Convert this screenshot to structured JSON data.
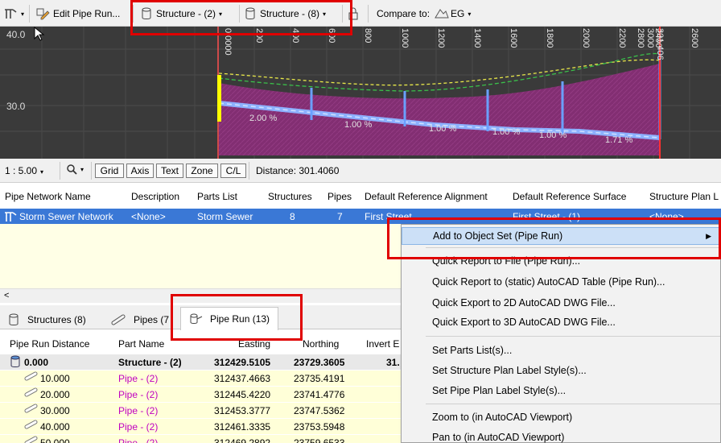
{
  "toolbar": {
    "edit_label": "Edit Pipe Run...",
    "struct_a": "Structure - (2)",
    "struct_b": "Structure - (8)",
    "compare_label": "Compare to:",
    "compare_value": "EG"
  },
  "profile": {
    "y_labels": [
      "40.0",
      "30.0"
    ],
    "stations": [
      "0.0000",
      "200",
      "400",
      "600",
      "800",
      "1000",
      "1200",
      "1400",
      "1600",
      "1800",
      "2000",
      "2200",
      "2400",
      "2600",
      "2800",
      "3000",
      "301.406"
    ],
    "slopes": [
      "2.00 %",
      "1.00 %",
      "1.00 %",
      "1.00 %",
      "1.00 %",
      "1.71 %"
    ]
  },
  "statusbar": {
    "scale": "1 : 5.00",
    "zoom_caret": "▾",
    "buttons": [
      "Grid",
      "Axis",
      "Text",
      "Zone",
      "C/L"
    ],
    "distance": "Distance: 301.4060"
  },
  "network_table": {
    "headers": [
      "Pipe Network Name",
      "Description",
      "Parts List",
      "Structures",
      "Pipes",
      "Default Reference Alignment",
      "Default Reference Surface",
      "Structure Plan L"
    ],
    "row": [
      "Storm Sewer Network",
      "<None>",
      "Storm Sewer",
      "8",
      "7",
      "First Street",
      "First Street - (1)",
      "<None>"
    ]
  },
  "tabs": {
    "structures": "Structures (8)",
    "pipes": "Pipes (7",
    "piperun": "Pipe Run (13)"
  },
  "run_table": {
    "headers": [
      "Pipe Run Distance",
      "Part Name",
      "Easting",
      "Northing",
      "Invert E"
    ],
    "rows": [
      {
        "dist": "0.000",
        "part": "Structure - (2)",
        "easting": "312429.5105",
        "northing": "23729.3605",
        "invert": "31."
      },
      {
        "dist": "10.000",
        "part": "Pipe - (2)",
        "easting": "312437.4663",
        "northing": "23735.4191",
        "invert": ""
      },
      {
        "dist": "20.000",
        "part": "Pipe - (2)",
        "easting": "312445.4220",
        "northing": "23741.4776",
        "invert": ""
      },
      {
        "dist": "30.000",
        "part": "Pipe - (2)",
        "easting": "312453.3777",
        "northing": "23747.5362",
        "invert": ""
      },
      {
        "dist": "40.000",
        "part": "Pipe - (2)",
        "easting": "312461.3335",
        "northing": "23753.5948",
        "invert": ""
      },
      {
        "dist": "50.000",
        "part": "Pipe - (2)",
        "easting": "312469.2892",
        "northing": "23759.6533",
        "invert": ""
      }
    ]
  },
  "context_menu": {
    "items": [
      "Add to Object Set (Pipe Run)",
      "Quick Report to File (Pipe Run)...",
      "Quick Report to (static) AutoCAD Table (Pipe Run)...",
      "Quick Export to 2D AutoCAD DWG File...",
      "Quick Export to 3D AutoCAD DWG File...",
      "Set Parts List(s)...",
      "Set Structure Plan Label Style(s)...",
      "Set Pipe Plan Label Style(s)...",
      "Zoom to (in AutoCAD Viewport)",
      "Pan to (in AutoCAD Viewport)"
    ],
    "submenu_arrow": "▶"
  }
}
